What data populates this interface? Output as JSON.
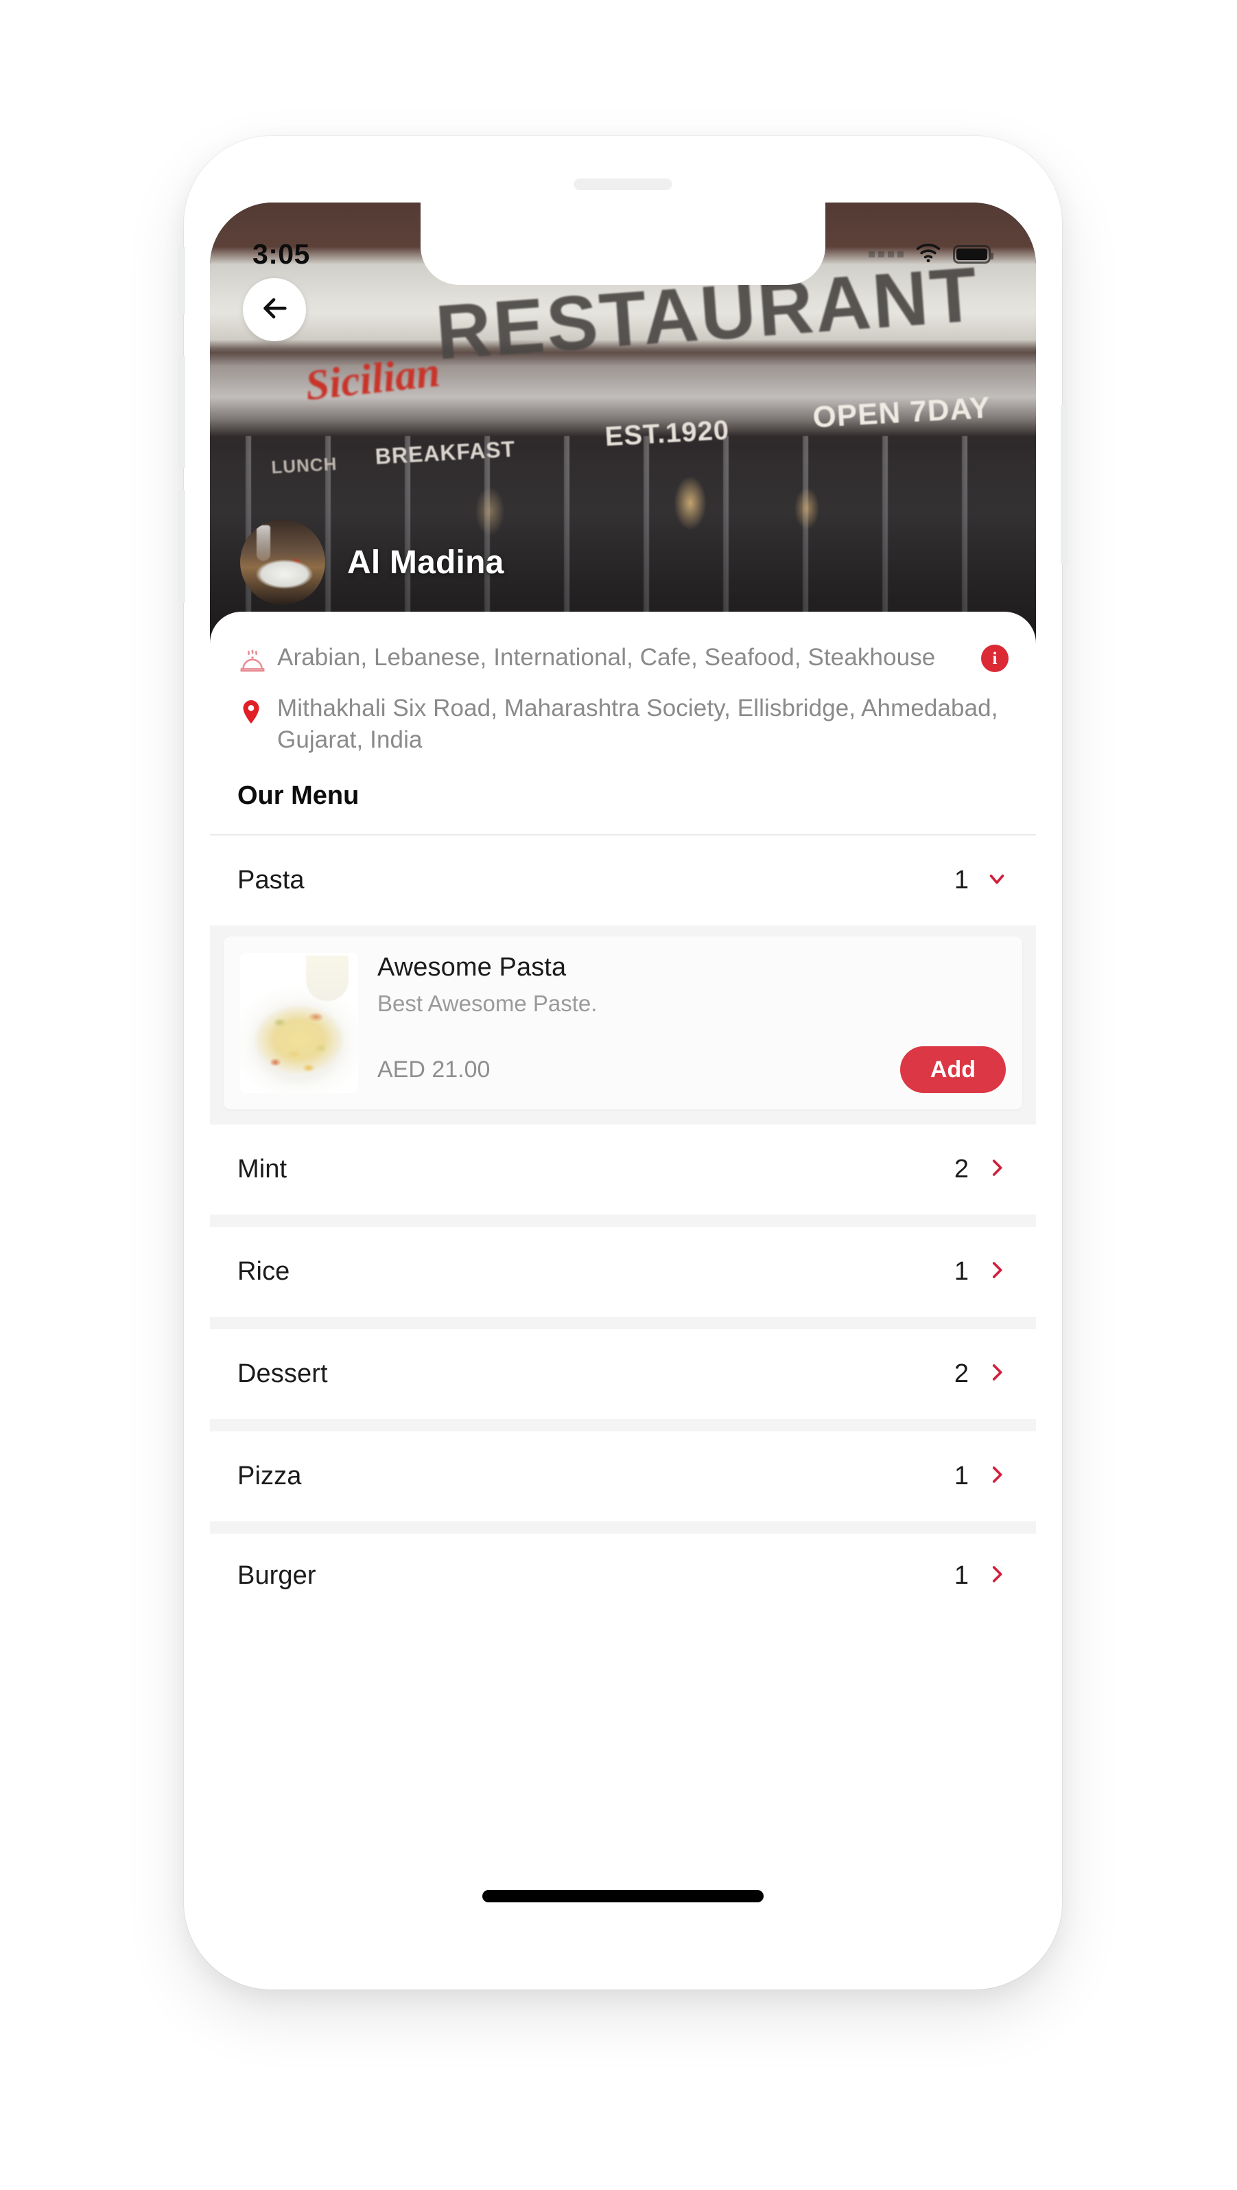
{
  "status_bar": {
    "time": "3:05",
    "cellular_icon": "cellular-dots-icon",
    "wifi_icon": "wifi-icon",
    "battery_icon": "battery-full-icon"
  },
  "header": {
    "back_icon": "back-arrow-icon",
    "restaurant_name": "Al Madina",
    "cover_photo_alt": "restaurant-storefront-photo",
    "cover_sign_text": "RESTAURANT",
    "cover_sign_script": "Sicilian",
    "cover_awning": {
      "lunch": "LUNCH",
      "breakfast": "BREAKFAST",
      "established": "EST.1920",
      "open": "OPEN 7DAY"
    },
    "avatar_alt": "restaurant-logo-avatar"
  },
  "info": {
    "cuisine_icon": "cloche-food-dome-icon",
    "cuisine": "Arabian, Lebanese, International, Cafe, Seafood, Steakhouse",
    "location_icon": "location-pin-icon",
    "address": "Mithakhali Six Road, Maharashtra Society, Ellisbridge, Ahmedabad, Gujarat, India",
    "info_badge_label": "i",
    "info_badge_icon": "info-circle-icon"
  },
  "menu": {
    "section_title": "Our Menu",
    "categories": [
      {
        "name": "Pasta",
        "count": "1",
        "expanded": true,
        "chevron": "chevron-down-icon"
      },
      {
        "name": "Mint",
        "count": "2",
        "expanded": false,
        "chevron": "chevron-right-icon"
      },
      {
        "name": "Rice",
        "count": "1",
        "expanded": false,
        "chevron": "chevron-right-icon"
      },
      {
        "name": "Dessert",
        "count": "2",
        "expanded": false,
        "chevron": "chevron-right-icon"
      },
      {
        "name": "Pizza",
        "count": "1",
        "expanded": false,
        "chevron": "chevron-right-icon"
      },
      {
        "name": "Burger",
        "count": "1",
        "expanded": false,
        "chevron": "chevron-right-icon"
      }
    ],
    "expanded_items": [
      {
        "name": "Awesome Pasta",
        "description": "Best Awesome Paste.",
        "price": "AED 21.00",
        "add_label": "Add",
        "thumb_alt": "awesome-pasta-photo"
      }
    ]
  },
  "colors": {
    "accent_red": "#DB3744",
    "info_badge_red": "#DB2A35",
    "chevron_red": "#D11F3C",
    "cuisine_icon_pink": "#E78C93",
    "pin_red": "#E01F26",
    "text_primary": "#1b1b1b",
    "text_muted": "#8a8a8a",
    "list_gap_gray": "#f4f4f4"
  }
}
